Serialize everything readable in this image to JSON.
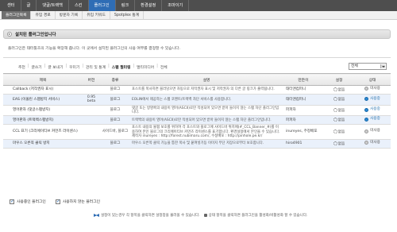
{
  "topnav": [
    "센터",
    "글",
    "댓글/트랙백",
    "스킨",
    "플러그인",
    "링크",
    "환경설정",
    "조마이기"
  ],
  "topnav_active": 4,
  "subnav": [
    "플러그인목록",
    "유입 경로",
    "방문자 기록",
    "유입 키워드",
    "Spotplex 통계"
  ],
  "subnav_active": 0,
  "title": "설치된 플러그인입니다",
  "description": "플러그인은 태터툴즈의 기능을 확장해 줍니다. 이 곳에서 설치된 플러그인의 사용 여부를 결정할 수 있습니다.",
  "filters": [
    "추천",
    "글쓰기",
    "글 보내기",
    "꾸미기",
    "관리 및 통계",
    "스팸 필터링",
    "멀티미디어",
    "전체"
  ],
  "filter_active": 5,
  "select_value": "전체",
  "table": {
    "headers": [
      "제목",
      "버전",
      "종류",
      "설명",
      "만든이",
      "설정",
      "상태"
    ],
    "rows": [
      {
        "name": "Callback (저작권자 표시)",
        "version": "",
        "kind": "블로그",
        "desc": "포스트를 복사하면 블러덩으면 자동으로 저작권자 표시 및 저작권자 의 다른 글 링크가 출력됩니다.",
        "author": "태터앤컴퍼니",
        "setting": "없음",
        "state": "미사용"
      },
      {
        "name": "EAS (이올린 스팸방지 서비스)",
        "version": "0.95 beta",
        "kind": "블로그",
        "desc": "EOLIN에서 제공하는 스팸 코멘트/트랙백 차단 서비스를 사용합니다.",
        "author": "태터앤컴퍼니",
        "setting": "없음",
        "state": "사용중"
      },
      {
        "name": "영어판자 (댓글스팸방지)",
        "version": "",
        "kind": "블로그",
        "desc": "댓글 또는 방명록의 내용이 영어(ASCII)로만 작성되어 있으면 받아 들이지 않는 스팸 차단 플러그인입니다.",
        "author": "파파자",
        "setting": "없음",
        "state": "사용중"
      },
      {
        "name": "영어판자 (트랙백스팸방지)",
        "version": "",
        "kind": "블로그",
        "desc": "트랙백의 내용이 영어(ASCII)로만 작성되어 있으면 받아 들이지 않는 스팸 차단 플러그인입니다.",
        "author": "파파자",
        "setting": "없음",
        "state": "사용중"
      },
      {
        "name": "CCL 표기 (크리에이티브 커먼즈 라이센스)",
        "version": "",
        "kind": "사이드바, 블로그",
        "desc": "포스트 내용의 불펌 보호를 위하여 각 포스트와 블로그에 사이드바 위치에(#_CCL_Banner_#)를 이용하여 본인 블로그의 크리에이티브 커먼즈 라이센스를 표기합니다. 환경설정에서 본인을 수 있습니다. 제작자 inureyes : http://forest.nubimaru.com/, 수정배포 : http://pinhole.pe.kr/",
        "author": "inureyes, 주정배포",
        "setting": "없음",
        "state": "미사용"
      },
      {
        "name": "마우스 오른쪽 클릭 방지",
        "version": "",
        "kind": "블로그",
        "desc": "마우스 오른쪽 클릭 기능을 통한 복사 및 붙여넣기등 이미지 무단 저장으로부터 보호합니다.",
        "author": "hiro4901",
        "setting": "없음",
        "state": "미사용"
      }
    ]
  },
  "checkbox_in_use": "사용중인 플러그인",
  "checkbox_not_in_use": "사용하지 않는 플러그인",
  "footer_text_a": "설정이 있는경우 각 항목을 클릭하면 설정창을 불러올 수 있습니다.",
  "footer_text_b": "상태 항목을 클릭하면 플러그인을 활성화/비활성화 할 수 있습니다.",
  "colors": {
    "nav_bg": "#4e4e4e",
    "nav_active": "#2f6db5",
    "row_alt": "#eaf1fb",
    "use": "#2a8ad6"
  }
}
